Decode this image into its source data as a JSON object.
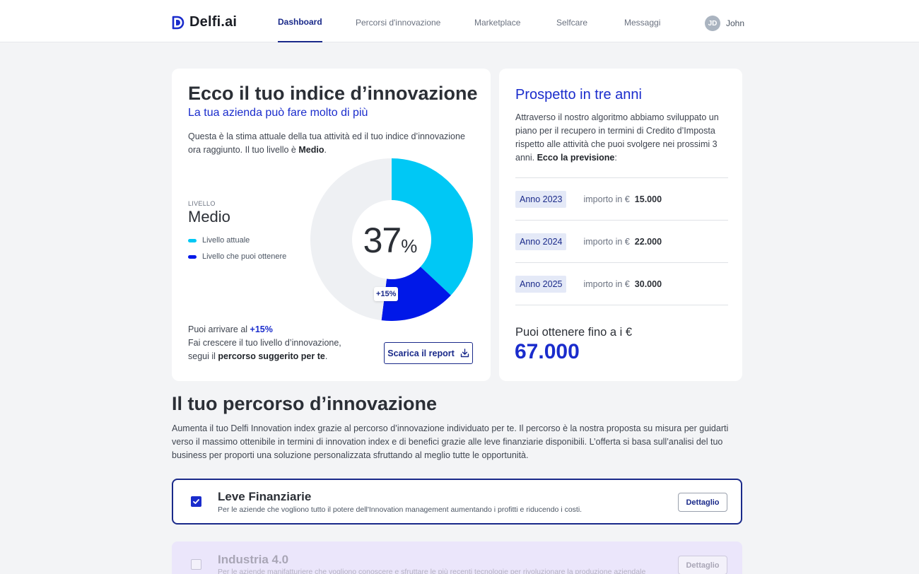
{
  "brand": {
    "name": "Delfi.ai",
    "accent": "#1a2ccc"
  },
  "nav": {
    "items": [
      {
        "label": "Dashboard",
        "active": true
      },
      {
        "label": "Percorsi d'innovazione",
        "active": false
      },
      {
        "label": "Marketplace",
        "active": false
      },
      {
        "label": "Selfcare",
        "active": false
      },
      {
        "label": "Messaggi",
        "active": false
      }
    ],
    "user": {
      "initials": "JD",
      "name": "John"
    }
  },
  "index_card": {
    "title": "Ecco il tuo indice d’innovazione",
    "subtitle": "La tua azienda può fare molto di più",
    "desc_pre": "Questa è la stima attuale della tua attività ed il tuo indice d’innovazione ora raggiunto. Il tuo livello è ",
    "desc_level": "Medio",
    "desc_post": ".",
    "level_label": "LIVELLO",
    "level_value": "Medio",
    "legend": [
      {
        "label": "Livello attuale",
        "color": "#00c8f5"
      },
      {
        "label": "Livello che puoi ottenere",
        "color": "#0018e8"
      }
    ],
    "percent": "37",
    "percent_sign": "%",
    "gain_badge": "+15%",
    "bottom_pre": "Puoi arrivare al ",
    "bottom_gain": "+15%",
    "bottom_line2": "Fai crescere il tuo livello d’innovazione,",
    "bottom_line3_pre": "segui il ",
    "bottom_line3_bold": "percorso suggerito per te",
    "bottom_line3_post": ".",
    "report_button": "Scarica il report"
  },
  "chart_data": {
    "type": "pie",
    "labels": [
      "Livello attuale",
      "Livello che puoi ottenere",
      "Rimanente"
    ],
    "values": [
      37,
      15,
      48
    ],
    "colors": [
      "#00c8f5",
      "#0018e8",
      "#eef0f3"
    ]
  },
  "forecast_card": {
    "title": "Prospetto in tre anni",
    "desc_pre": "Attraverso il nostro algoritmo abbiamo sviluppato un piano per il recupero in termini di Credito d’Imposta rispetto alle attività che puoi svolgere nei prossimi 3 anni. ",
    "desc_bold": "Ecco la previsione",
    "desc_post": ":",
    "rows": [
      {
        "year": "Anno 2023",
        "label": "importo in €",
        "value": "15.000"
      },
      {
        "year": "Anno 2024",
        "label": "importo in €",
        "value": "22.000"
      },
      {
        "year": "Anno 2025",
        "label": "importo in €",
        "value": "30.000"
      }
    ],
    "total_label": "Puoi ottenere fino a i €",
    "total_value": "67.000"
  },
  "path_section": {
    "title": "Il tuo percorso d’innovazione",
    "desc": "Aumenta il tuo Delfi Innovation index grazie al percorso d’innovazione individuato per te. Il percorso è la nostra proposta su misura per guidarti verso il massimo ottenibile in termini di innovation index e di benefici grazie alle leve finanziarie disponibili. L’offerta si basa sull’analisi del tuo business per proporti una soluzione personalizzata sfruttando al meglio tutte le opportunità.",
    "items": [
      {
        "title": "Leve Finanziarie",
        "desc": "Per le aziende che vogliono tutto il potere dell'Innovation management aumentando i profitti e riducendo i costi.",
        "button": "Dettaglio",
        "checked": true
      },
      {
        "title": "Industria 4.0",
        "desc": "Per le aziende manifatturiere che vogliono conoscere e sfruttare le più recenti tecnologie per rivoluzionare la produzione aziendale",
        "button": "Dettaglio",
        "checked": false
      }
    ]
  }
}
